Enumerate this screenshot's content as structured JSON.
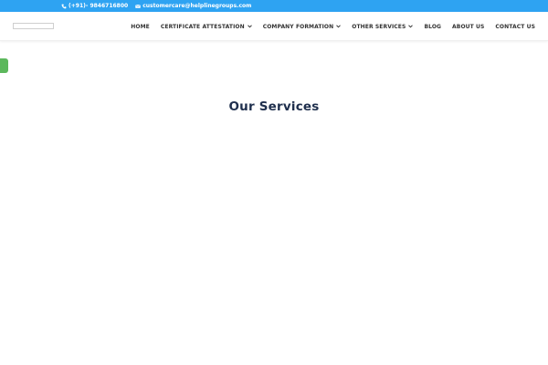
{
  "topbar": {
    "phone": "(+91)- 9846716800",
    "email": "customercare@helplinegroups.com",
    "background_color": "#2ea3f2"
  },
  "nav": {
    "items": [
      {
        "label": "HOME",
        "has_dropdown": false
      },
      {
        "label": "CERTIFICATE ATTESTATION",
        "has_dropdown": true
      },
      {
        "label": "COMPANY FORMATION",
        "has_dropdown": true
      },
      {
        "label": "OTHER SERVICES",
        "has_dropdown": true
      },
      {
        "label": "BLOG",
        "has_dropdown": false
      },
      {
        "label": "ABOUT US",
        "has_dropdown": false
      },
      {
        "label": "CONTACT US",
        "has_dropdown": false
      }
    ]
  },
  "main": {
    "section_title": "Our Services"
  },
  "colors": {
    "accent": "#2ea3f2",
    "title": "#1f2f4d",
    "side_tab": "#5cb85c"
  },
  "icons": {
    "phone": "phone-icon",
    "email": "envelope-icon",
    "dropdown": "chevron-down-icon"
  }
}
